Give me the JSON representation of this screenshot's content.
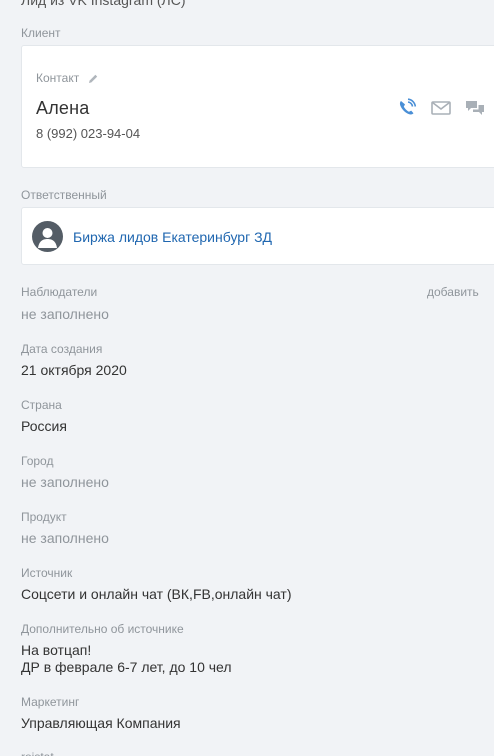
{
  "top_cut_text": "Лид из VK Instagram (ЛС)",
  "client": {
    "section_label": "Клиент",
    "contact_label": "Контакт",
    "name": "Алена",
    "phone": "8 (992) 023-94-04"
  },
  "responsible": {
    "section_label": "Ответственный",
    "name": "Биржа лидов Екатеринбург ЗД"
  },
  "fields": {
    "observers": {
      "label": "Наблюдатели",
      "value": "не заполнено",
      "add_label": "добавить"
    },
    "created": {
      "label": "Дата создания",
      "value": "21 октября 2020"
    },
    "country": {
      "label": "Страна",
      "value": "Россия"
    },
    "city": {
      "label": "Город",
      "value": "не заполнено"
    },
    "product": {
      "label": "Продукт",
      "value": "не заполнено"
    },
    "source": {
      "label": "Источник",
      "value": "Соцсети и онлайн чат (ВК,FB,онлайн чат)"
    },
    "source_extra": {
      "label": "Дополнительно об источнике",
      "line1": "На вотцап!",
      "line2": "ДР в феврале 6-7 лет, до 10 чел"
    },
    "marketing": {
      "label": "Маркетинг",
      "value": "Управляющая Компания"
    },
    "cut_bottom_label": "roistat"
  },
  "colors": {
    "accent": "#2067b0",
    "phone_icon": "#4a8fd6",
    "muted": "#8f959b",
    "background": "#f1f3f6"
  }
}
